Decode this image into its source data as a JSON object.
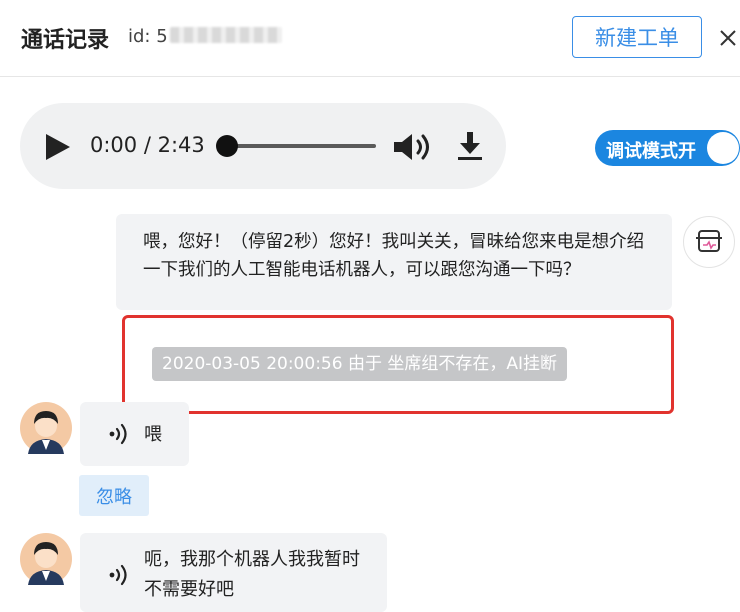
{
  "header": {
    "title": "通话记录",
    "id_label": "id: 5",
    "new_ticket_button": "新建工单",
    "close_icon": "close-icon"
  },
  "player": {
    "current_time": "0:00",
    "duration": "2:43",
    "time_display": "0:00 / 2:43",
    "progress": 0,
    "icons": [
      "play-icon",
      "volume-icon",
      "download-icon"
    ]
  },
  "debug_toggle": {
    "label": "调试模式开",
    "on": true
  },
  "conversation": {
    "bot_message": "喂，您好！（停留2秒）您好！我叫关关，冒昧给您来电是想介绍一下我们的人工智能电话机器人，可以跟您沟通一下吗？",
    "system_event": "2020-03-05 20:00:56 由于 坐席组不存在，AI挂断",
    "user_messages": [
      {
        "text": "喂"
      },
      {
        "text": "呃，我那个机器人我我暂时不需要好吧"
      }
    ],
    "ignore_button": "忽略"
  },
  "colors": {
    "accent": "#3a8ee6",
    "toggle_bg": "#1b86e0",
    "highlight_border": "#e1332e",
    "bubble_bg": "#f2f3f5",
    "system_pill": "#c5c6c8"
  }
}
